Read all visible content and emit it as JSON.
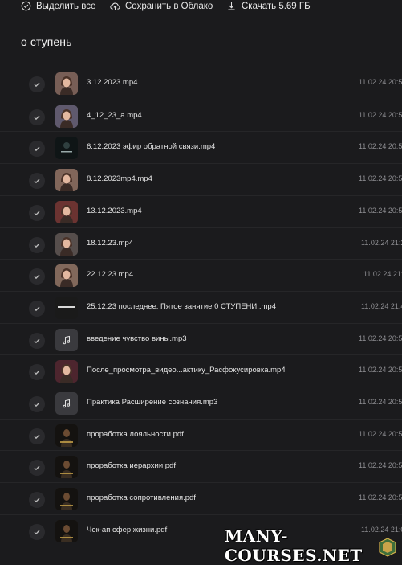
{
  "toolbar": {
    "select_all": "Выделить все",
    "save_cloud": "Сохранить в Облако",
    "download": "Скачать 5.69 ГБ"
  },
  "folder_title": "о ступень",
  "files": [
    {
      "name": "3.12.2023.mp4",
      "date": "11.02.24 20:5",
      "thumb": "face",
      "color": "#b78878"
    },
    {
      "name": "4_12_23_a.mp4",
      "date": "11.02.24 20:5",
      "thumb": "face",
      "color": "#8b7fa3"
    },
    {
      "name": "6.12.2023 эфир обратной связи.mp4",
      "date": "11.02.24 20:5",
      "thumb": "dark",
      "color": "#1a2224"
    },
    {
      "name": "8.12.2023mp4.mp4",
      "date": "11.02.24 20:5",
      "thumb": "face",
      "color": "#c99880"
    },
    {
      "name": "13.12.2023.mp4",
      "date": "11.02.24 20:5",
      "thumb": "face",
      "color": "#a03a34"
    },
    {
      "name": "18.12.23.mp4",
      "date": "11.02.24 21:2",
      "thumb": "face",
      "color": "#7a6c66"
    },
    {
      "name": "22.12.23.mp4",
      "date": "11.02.24 21:",
      "thumb": "face",
      "color": "#c99a82"
    },
    {
      "name": "25.12.23 последнее. Пятое занятие 0 СТУПЕНИ,.mp4",
      "date": "11.02.24 21:4",
      "thumb": "text",
      "color": "#1e1e1e"
    },
    {
      "name": "введение чувство вины.mp3",
      "date": "11.02.24 20:5",
      "thumb": "audio",
      "color": "#3a3a3e"
    },
    {
      "name": "После_просмотра_видео...актику_Расфокусировка.mp4",
      "date": "11.02.24 20:5",
      "thumb": "face",
      "color": "#6a2030"
    },
    {
      "name": "Практика Расширение сознания.mp3",
      "date": "11.02.24 20:5",
      "thumb": "audio",
      "color": "#3a3a3e"
    },
    {
      "name": "проработка лояльности.pdf",
      "date": "11.02.24 20:5",
      "thumb": "doc",
      "color": "#2a2418"
    },
    {
      "name": "проработка иерархии.pdf",
      "date": "11.02.24 20:5",
      "thumb": "doc",
      "color": "#2a2418"
    },
    {
      "name": "проработка сопротивления.pdf",
      "date": "11.02.24 20:5",
      "thumb": "doc",
      "color": "#2a2418"
    },
    {
      "name": "Чек-ап сфер жизни.pdf",
      "date": "11.02.24 21:0",
      "thumb": "doc",
      "color": "#2a2418"
    }
  ],
  "watermark": "MANY-COURSES.NET"
}
